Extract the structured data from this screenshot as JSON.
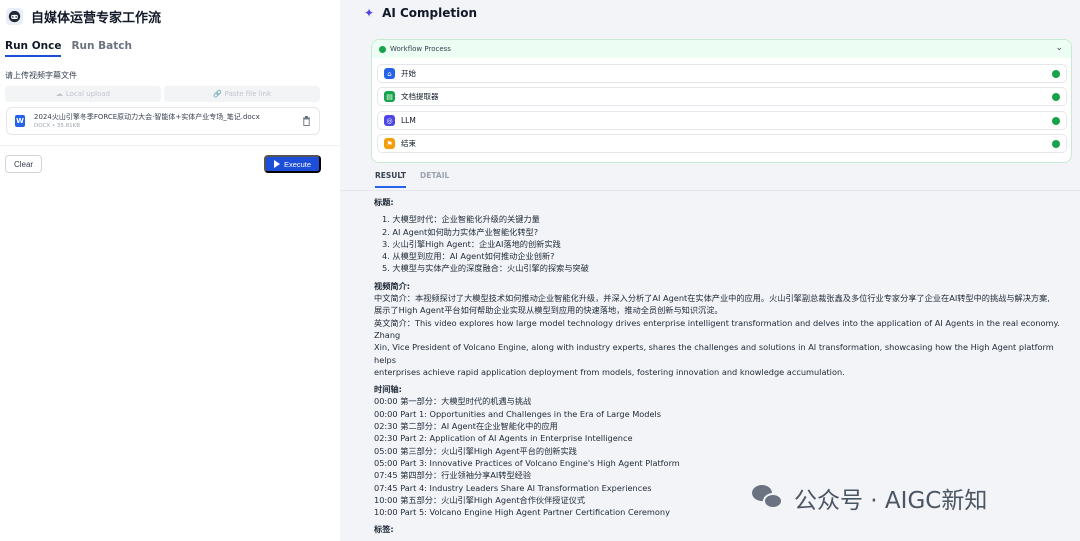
{
  "app": {
    "title": "自媒体运营专家工作流"
  },
  "tabs": [
    {
      "label": "Run Once",
      "active": true
    },
    {
      "label": "Run Batch",
      "active": false
    }
  ],
  "upload": {
    "label": "请上传视频字幕文件",
    "local_upload": "Local upload",
    "paste_link": "Paste file link",
    "file": {
      "name": "2024火山引擎冬季FORCE原动力大会·智能体+实体产业专场_笔记.docx",
      "meta": "DOCX • 35.81KB",
      "icon": "W"
    }
  },
  "actions": {
    "clear": "Clear",
    "execute": "Execute"
  },
  "completion": {
    "title": "AI Completion"
  },
  "workflow": {
    "header": "Workflow Process",
    "nodes": [
      {
        "label": "开始",
        "icon": "home-icon",
        "color": "#2563eb",
        "status": "success"
      },
      {
        "label": "文档提取器",
        "icon": "document-icon",
        "color": "#16a34a",
        "status": "success"
      },
      {
        "label": "LLM",
        "icon": "llm-icon",
        "color": "#4f46e5",
        "status": "success"
      },
      {
        "label": "结束",
        "icon": "flag-icon",
        "color": "#f59e0b",
        "status": "success"
      }
    ]
  },
  "result_tabs": [
    {
      "label": "RESULT",
      "active": true
    },
    {
      "label": "DETAIL",
      "active": false
    }
  ],
  "result": {
    "titles_heading": "标题:",
    "titles": [
      "1. 大模型时代：企业智能化升级的关键力量",
      "2. AI Agent如何助力实体产业智能化转型?",
      "3. 火山引擎High Agent：企业AI落地的创新实践",
      "4. 从模型到应用：AI Agent如何推动企业创新?",
      "5. 大模型与实体产业的深度融合：火山引擎的探索与突破"
    ],
    "intro_heading": "视频简介:",
    "intro_lines": [
      "中文简介：本视频探讨了大模型技术如何推动企业智能化升级，并深入分析了AI Agent在实体产业中的应用。火山引擎副总裁张鑫及多位行业专家分享了企业在AI转型中的挑战与解决方案,",
      "展示了High Agent平台如何帮助企业实现从模型到应用的快速落地，推动全员创新与知识沉淀。",
      "英文简介：This video explores how large model technology drives enterprise intelligent transformation and delves into the application of AI Agents in the real economy. Zhang",
      "Xin, Vice President of Volcano Engine, along with industry experts, shares the challenges and solutions in AI transformation, showcasing how the High Agent platform helps",
      "enterprises achieve rapid application deployment from models, fostering innovation and knowledge accumulation."
    ],
    "timeline_heading": "时间轴:",
    "timeline": [
      "00:00 第一部分：大模型时代的机遇与挑战",
      "00:00 Part 1: Opportunities and Challenges in the Era of Large Models",
      "02:30 第二部分：AI Agent在企业智能化中的应用",
      "02:30 Part 2: Application of AI Agents in Enterprise Intelligence",
      "05:00 第三部分：火山引擎High Agent平台的创新实践",
      "05:00 Part 3: Innovative Practices of Volcano Engine's High Agent Platform",
      "07:45 第四部分：行业领袖分享AI转型经验",
      "07:45 Part 4: Industry Leaders Share AI Transformation Experiences",
      "10:00 第五部分：火山引擎High Agent合作伙伴授证仪式",
      "10:00 Part 5: Volcano Engine High Agent Partner Certification Ceremony"
    ],
    "tags_heading": "标签:"
  },
  "watermark": {
    "text": "公众号 · AIGC新知"
  }
}
